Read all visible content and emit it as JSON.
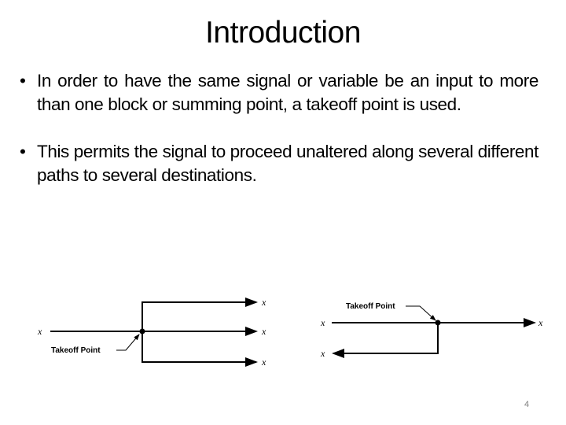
{
  "slide": {
    "title": "Introduction",
    "bullets": [
      {
        "marker": "•",
        "text": "In order to have the same signal or variable be an input to more than one block or summing point, a takeoff point is used."
      },
      {
        "marker": "•",
        "text": "This permits the signal to proceed unaltered along several different paths to several destinations."
      }
    ],
    "page_number": "4"
  },
  "diagrams": {
    "left": {
      "input_label": "x",
      "outputs": [
        "x",
        "x",
        "x"
      ],
      "annotation": "Takeoff Point"
    },
    "right": {
      "input_label": "x",
      "output_forward": "x",
      "output_back": "x",
      "annotation": "Takeoff Point"
    }
  }
}
